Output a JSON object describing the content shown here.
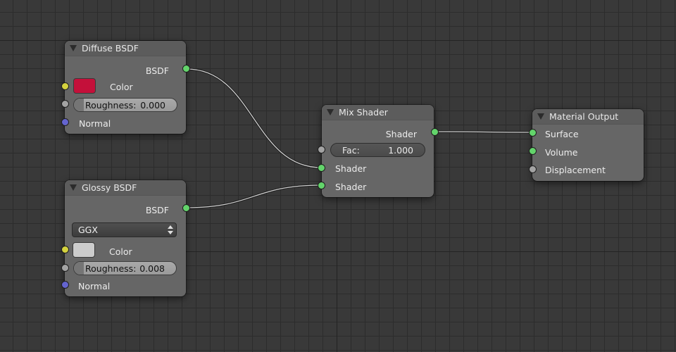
{
  "nodes": {
    "diffuse": {
      "title": "Diffuse BSDF",
      "output_label": "BSDF",
      "color_label": "Color",
      "color_value": "#c4103a",
      "roughness_label": "Roughness:",
      "roughness_value": "0.000",
      "normal_label": "Normal"
    },
    "glossy": {
      "title": "Glossy BSDF",
      "output_label": "BSDF",
      "distribution_value": "GGX",
      "color_label": "Color",
      "color_value": "#cccccc",
      "roughness_label": "Roughness:",
      "roughness_value": "0.008",
      "normal_label": "Normal"
    },
    "mix": {
      "title": "Mix Shader",
      "output_label": "Shader",
      "fac_label": "Fac:",
      "fac_value": "1.000",
      "input1_label": "Shader",
      "input2_label": "Shader"
    },
    "output": {
      "title": "Material Output",
      "surface_label": "Surface",
      "volume_label": "Volume",
      "displacement_label": "Displacement"
    }
  },
  "colors": {
    "background": "#393939",
    "node_body": "#666666",
    "socket_shader": "#63d46b",
    "socket_color": "#d4d23e",
    "socket_value": "#a3a3a3",
    "socket_vector": "#6464cf",
    "link": "#d0d0d0"
  },
  "links": [
    {
      "from": "diffuse.BSDF",
      "to": "mix.Shader(1)"
    },
    {
      "from": "glossy.BSDF",
      "to": "mix.Shader(2)"
    },
    {
      "from": "mix.Shader",
      "to": "output.Surface"
    }
  ]
}
